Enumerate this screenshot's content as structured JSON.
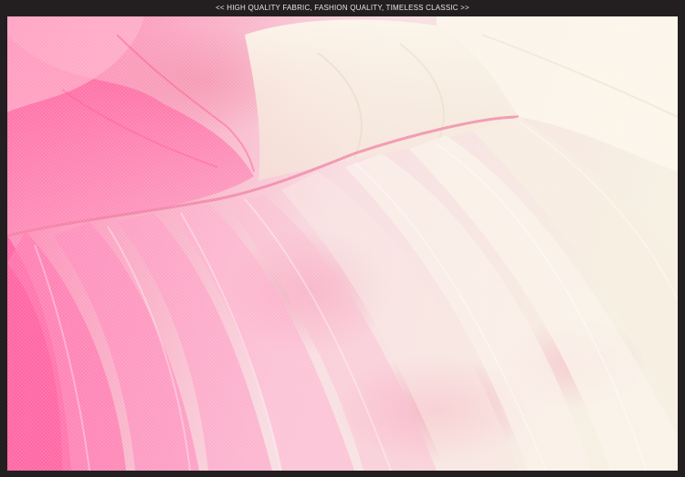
{
  "banner": {
    "text": "<< HIGH QUALITY FABRIC, FASHION QUALITY, TIMELESS CLASSIC >>"
  },
  "photo": {
    "subject": "tulle-skirt-closeup",
    "colors": {
      "frame": "#231f20",
      "hot_pink": "#ff6ea6",
      "soft_pink": "#f7b9cb",
      "pale_pink": "#fde2ea",
      "cream": "#f5efe1",
      "ivory": "#faf6ee"
    }
  }
}
